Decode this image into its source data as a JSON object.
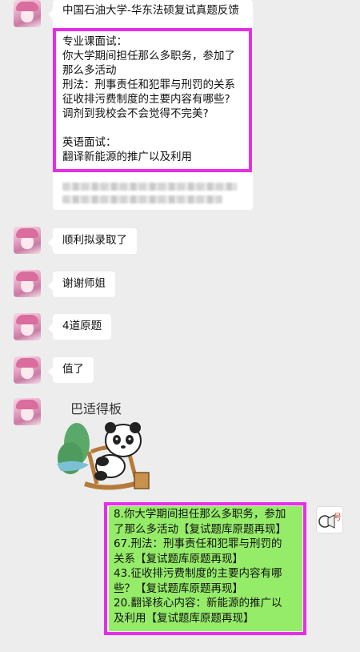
{
  "messages": {
    "first": {
      "title": "中国石油大学-华东法硕复试真题反馈",
      "lines": [
        "专业课面试：",
        "你大学期间担任那么多职务，参加了",
        "那么多活动",
        "刑法：刑事责任和犯罪与刑罚的关系",
        "征收排污费制度的主要内容有哪些?",
        "调剂到我校会不会觉得不完美?",
        "",
        "英语面试：",
        "翻译新能源的推广以及利用"
      ]
    },
    "m2": "顺利拟录取了",
    "m3": "谢谢师姐",
    "m4": "4道原题",
    "m5": "值了",
    "sticker_text": "巴适得板",
    "reply_lines": [
      "8.你大学期间担任那么多职务，参加",
      "了那么多活动【复试题库原题再现】",
      "67.刑法：刑事责任和犯罪与刑罚的",
      "关系【复试题库原题再现】",
      "43.征收排污费制度的主要内容有哪",
      "些？【复试题库原题再现】",
      "20.翻译核心内容：新能源的推广以",
      "及利用【复试题库原题再现】"
    ],
    "right_sticker_text": "号"
  },
  "colors": {
    "highlight": "#e62ee6",
    "green_bubble": "#95ec69",
    "background": "#ededed"
  }
}
